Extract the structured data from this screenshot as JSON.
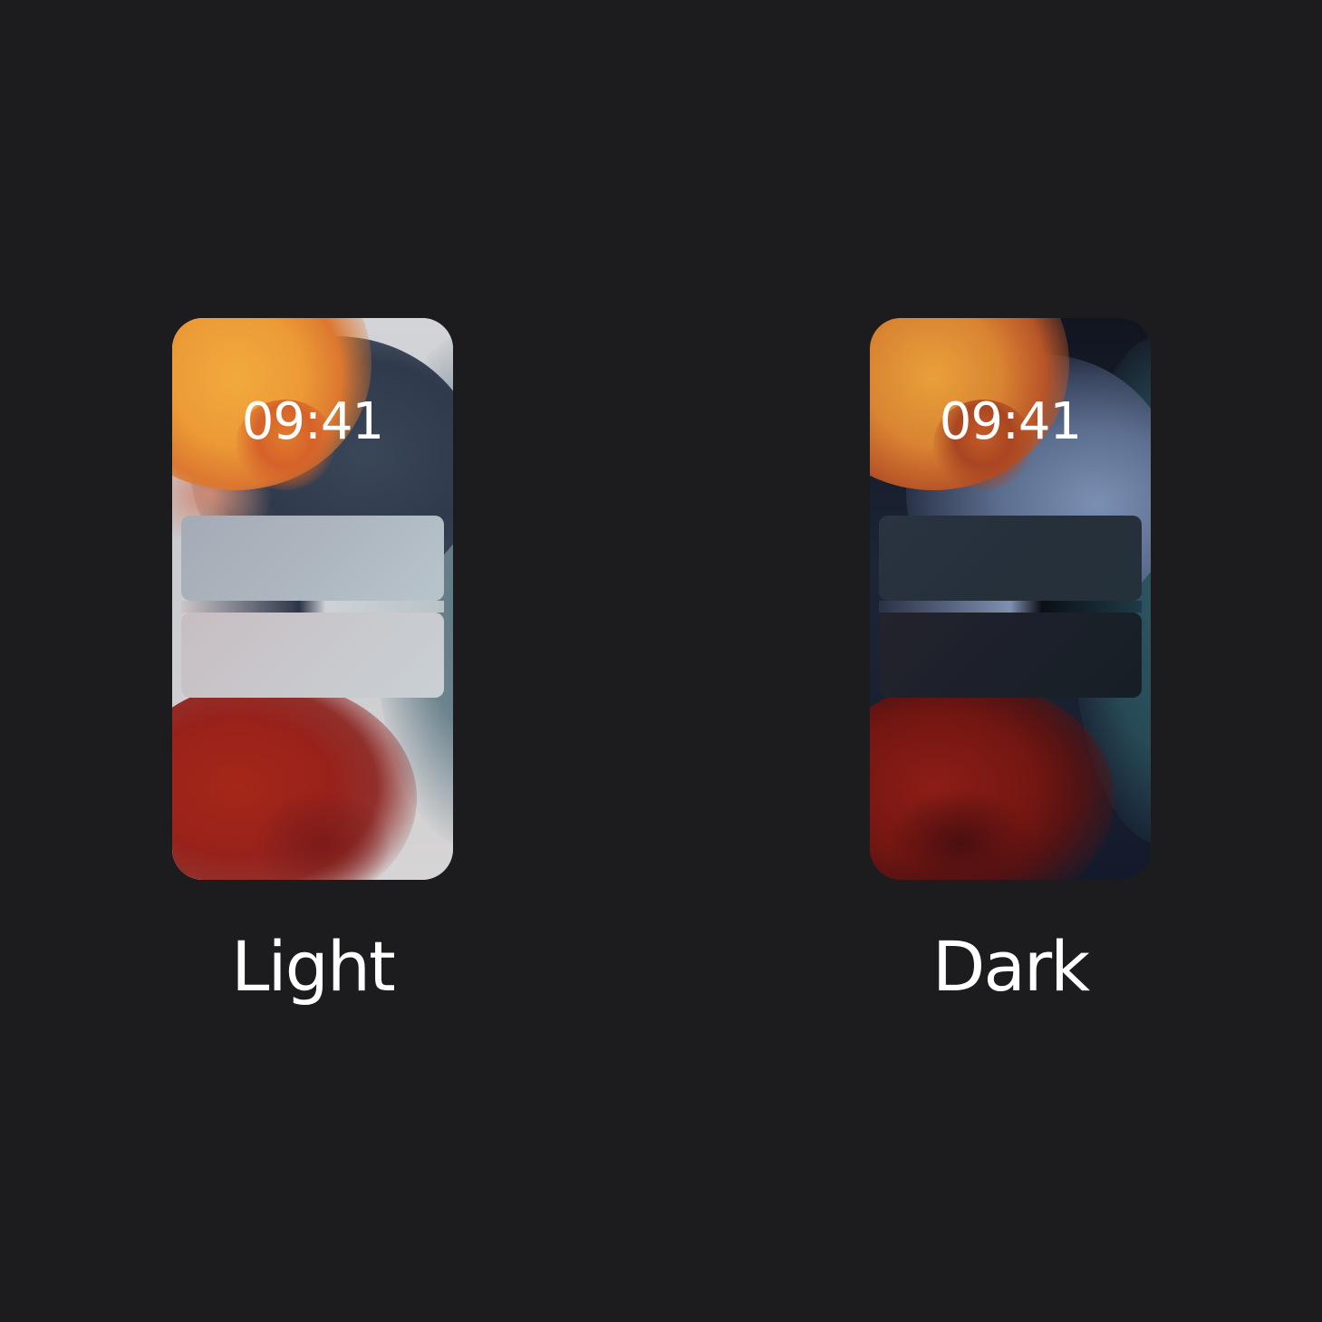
{
  "options": [
    {
      "id": "light",
      "label": "Light",
      "time": "09:41"
    },
    {
      "id": "dark",
      "label": "Dark",
      "time": "09:41"
    }
  ],
  "colors": {
    "background": "#1c1c1e",
    "text": "#ffffff"
  }
}
